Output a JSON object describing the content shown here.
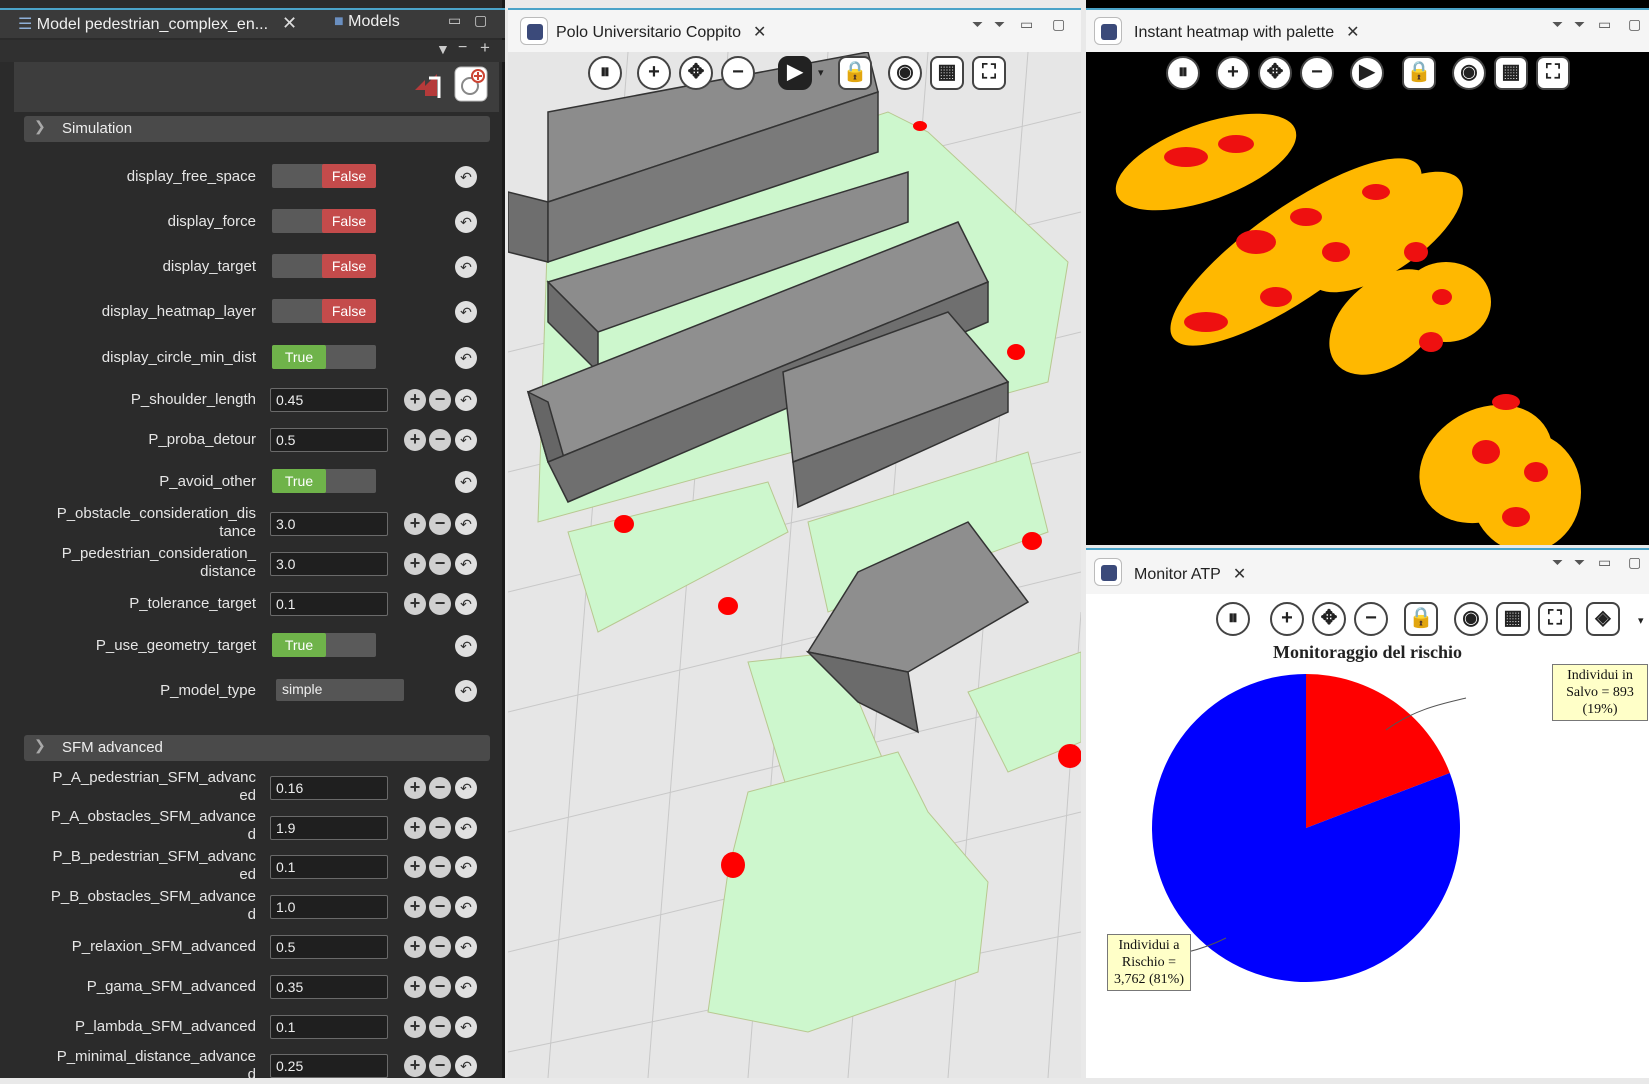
{
  "left_panel": {
    "tabs": [
      {
        "label": "Model pedestrian_complex_en...",
        "close": "✕"
      },
      {
        "label": "Models"
      }
    ],
    "sections": [
      {
        "title": "Simulation"
      },
      {
        "title": "SFM advanced"
      }
    ],
    "params": [
      {
        "label": "display_free_space",
        "kind": "bool",
        "value": "False"
      },
      {
        "label": "display_force",
        "kind": "bool",
        "value": "False"
      },
      {
        "label": "display_target",
        "kind": "bool",
        "value": "False"
      },
      {
        "label": "display_heatmap_layer",
        "kind": "bool",
        "value": "False"
      },
      {
        "label": "display_circle_min_dist",
        "kind": "bool",
        "value": "True"
      },
      {
        "label": "P_shoulder_length",
        "kind": "num",
        "value": "0.45"
      },
      {
        "label": "P_proba_detour",
        "kind": "num",
        "value": "0.5"
      },
      {
        "label": "P_avoid_other",
        "kind": "bool",
        "value": "True"
      },
      {
        "label": "P_obstacle_consideration_dis\ntance",
        "kind": "num",
        "value": "3.0"
      },
      {
        "label": "P_pedestrian_consideration_\ndistance",
        "kind": "num",
        "value": "3.0"
      },
      {
        "label": "P_tolerance_target",
        "kind": "num",
        "value": "0.1"
      },
      {
        "label": "P_use_geometry_target",
        "kind": "bool",
        "value": "True"
      },
      {
        "label": "P_model_type",
        "kind": "select",
        "value": "simple"
      },
      {
        "label": "P_A_pedestrian_SFM_advanc\ned",
        "kind": "num",
        "value": "0.16"
      },
      {
        "label": "P_A_obstacles_SFM_advance\nd",
        "kind": "num",
        "value": "1.9"
      },
      {
        "label": "P_B_pedestrian_SFM_advanc\ned",
        "kind": "num",
        "value": "0.1"
      },
      {
        "label": "P_B_obstacles_SFM_advance\nd",
        "kind": "num",
        "value": "1.0"
      },
      {
        "label": "P_relaxion_SFM_advanced",
        "kind": "num",
        "value": "0.5"
      },
      {
        "label": "P_gama_SFM_advanced",
        "kind": "num",
        "value": "0.35"
      },
      {
        "label": "P_lambda_SFM_advanced",
        "kind": "num",
        "value": "0.1"
      },
      {
        "label": "P_minimal_distance_advance\nd",
        "kind": "num",
        "value": "0.25"
      }
    ]
  },
  "center_view": {
    "title": "Polo Universitario Coppito",
    "close": "✕"
  },
  "heatmap_view": {
    "title": "Instant heatmap with palette",
    "close": "✕"
  },
  "monitor_view": {
    "title": "Monitor ATP",
    "close": "✕",
    "chart_title": "Monitoraggio del rischio"
  },
  "chart_data": {
    "type": "pie",
    "title": "Monitoraggio del rischio",
    "slices": [
      {
        "label": "Individui in Salvo = 893 (19%)",
        "value": 893,
        "percent": 19,
        "color": "#ff0000"
      },
      {
        "label": "Individui a Rischio = 3,762 (81%)",
        "value": 3762,
        "percent": 81,
        "color": "#0000ff"
      }
    ],
    "callouts": [
      "Individui in\nSalvo = 893\n(19%)",
      "Individui a\nRischio =\n3,762 (81%)"
    ]
  },
  "colors": {
    "true": "#6fb34a",
    "false": "#c44b4b",
    "accent": "#4aa3c8"
  }
}
